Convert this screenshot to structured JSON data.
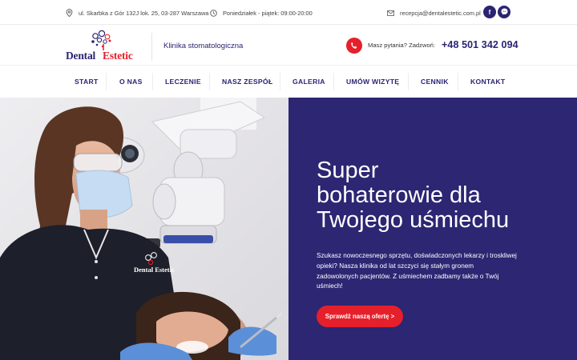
{
  "topbar": {
    "address": "ul. Skarbka z Gór 132J lok. 25, 03-287 Warszawa",
    "hours": "Poniedziałek - piątek: 09:00-20:00",
    "email": "recepcja@dentalestetic.com.pl",
    "social": [
      {
        "icon": "facebook-icon",
        "label": "f"
      },
      {
        "icon": "messenger-icon",
        "label": ""
      }
    ]
  },
  "header": {
    "logo_part1": "Dental",
    "logo_part2": "Estetic",
    "tagline": "Klinika stomatologiczna",
    "phone_question": "Masz pytania? Zadzwoń:",
    "phone_number": "+48 501 342 094"
  },
  "nav": {
    "items": [
      {
        "label": "START",
        "active": true
      },
      {
        "label": "O NAS"
      },
      {
        "label": "LECZENIE"
      },
      {
        "label": "NASZ ZESPÓŁ"
      },
      {
        "label": "GALERIA"
      },
      {
        "label": "UMÓW WIZYTĘ"
      },
      {
        "label": "CENNIK"
      },
      {
        "label": "KONTAKT"
      }
    ]
  },
  "hero": {
    "title_line1": "Super",
    "title_line2": "bohaterowie dla",
    "title_line3": "Twojego uśmiechu",
    "text": "Szukasz nowoczesnego sprzętu, doświadczonych lekarzy i troskliwej opieki? Nasza klinika od lat szczyci się stałym gronem zadowolonych pacjentów. Z uśmiechem zadbamy także o Twój uśmiech!",
    "cta": "Sprawdź naszą ofertę >",
    "photo_badge": "Dental Estetic"
  },
  "colors": {
    "brand_navy": "#2c2673",
    "accent_red": "#e5202b"
  }
}
